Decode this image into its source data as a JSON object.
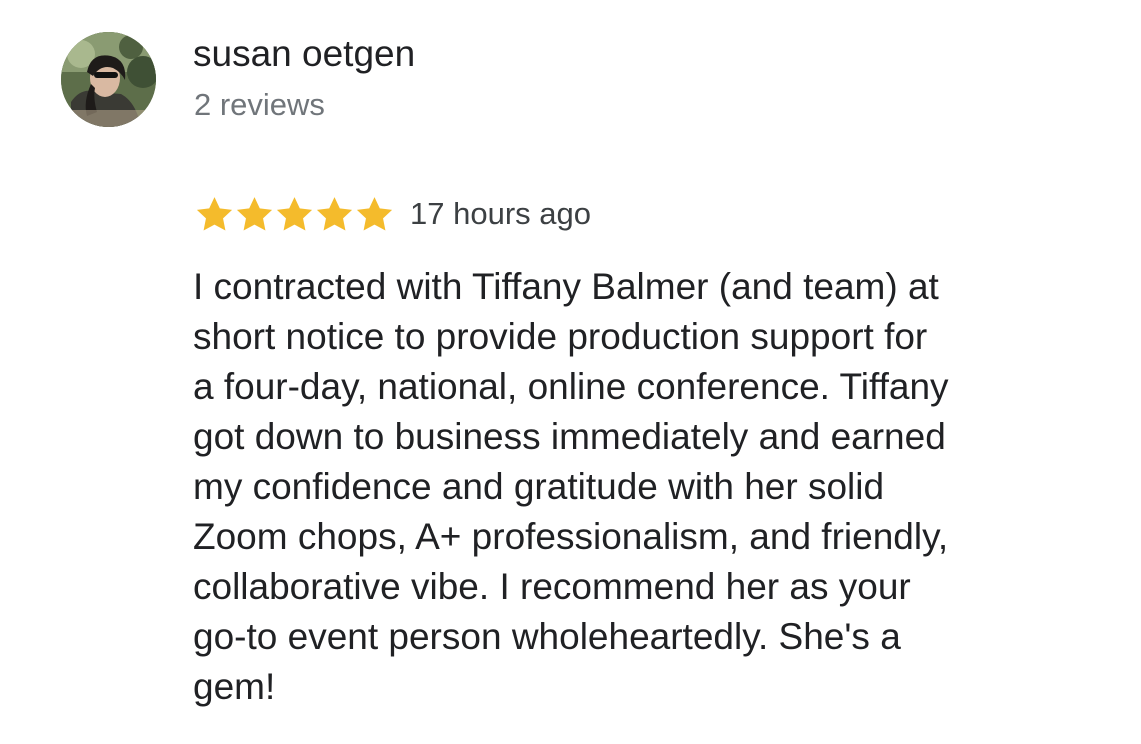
{
  "reviewer": {
    "name": "susan oetgen",
    "review_count": "2 reviews",
    "avatar_icon": "profile-photo"
  },
  "review": {
    "rating": 5,
    "rating_max": 5,
    "star_color": "#f4bb2c",
    "time": "17 hours ago",
    "text": "I contracted with Tiffany Balmer (and team) at\nshort notice to provide production support for\na four-day, national, online conference.  Tiffany\ngot down to business immediately and earned\nmy confidence and gratitude with her solid\nZoom chops, A+ professionalism, and friendly,\ncollaborative vibe.  I recommend her as your\ngo-to event person wholeheartedly.  She's a\ngem!"
  }
}
